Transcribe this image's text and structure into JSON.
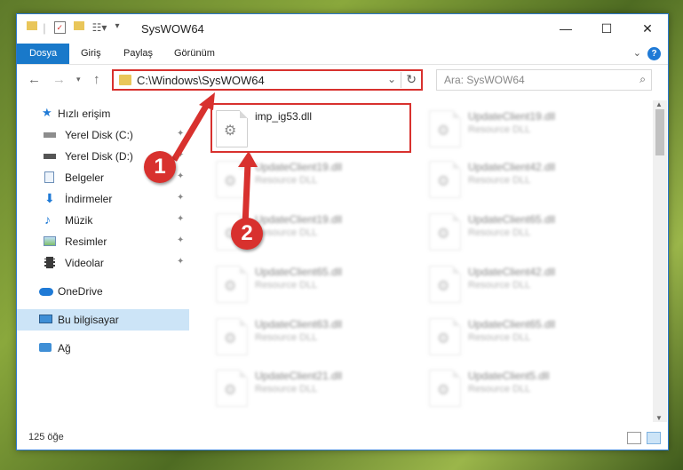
{
  "window": {
    "title": "SysWOW64"
  },
  "window_controls": {
    "minimize": "—",
    "maximize": "☐",
    "close": "✕"
  },
  "ribbon": {
    "tabs": [
      "Dosya",
      "Giriş",
      "Paylaş",
      "Görünüm"
    ],
    "help": "?"
  },
  "address": {
    "path": "C:\\Windows\\SysWOW64"
  },
  "search": {
    "placeholder": "Ara: SysWOW64"
  },
  "sidebar": {
    "items": [
      {
        "label": "Hızlı erişim",
        "icon": "star-icon"
      },
      {
        "label": "Yerel Disk (C:)",
        "icon": "drive-icon"
      },
      {
        "label": "Yerel Disk (D:)",
        "icon": "drive-icon"
      },
      {
        "label": "Belgeler",
        "icon": "documents-icon"
      },
      {
        "label": "İndirmeler",
        "icon": "download-arrow-icon"
      },
      {
        "label": "Müzik",
        "icon": "music-note-icon"
      },
      {
        "label": "Resimler",
        "icon": "pictures-icon"
      },
      {
        "label": "Videolar",
        "icon": "film-icon"
      },
      {
        "label": "OneDrive",
        "icon": "cloud-icon"
      },
      {
        "label": "Bu bilgisayar",
        "icon": "computer-icon",
        "selected": true
      },
      {
        "label": "Ağ",
        "icon": "network-icon"
      }
    ]
  },
  "files": [
    {
      "name": "imp_ig53.dll",
      "desc": "",
      "highlighted": true
    },
    {
      "name": "UpdateClient19.dll",
      "desc": "Resource DLL"
    },
    {
      "name": "UpdateClient19.dll",
      "desc": "Resource DLL"
    },
    {
      "name": "UpdateClient42.dll",
      "desc": "Resource DLL"
    },
    {
      "name": "UpdateClient19.dll",
      "desc": "Resource DLL"
    },
    {
      "name": "UpdateClient65.dll",
      "desc": "Resource DLL"
    },
    {
      "name": "UpdateClient65.dll",
      "desc": "Resource DLL"
    },
    {
      "name": "UpdateClient42.dll",
      "desc": "Resource DLL"
    },
    {
      "name": "UpdateClient63.dll",
      "desc": "Resource DLL"
    },
    {
      "name": "UpdateClient65.dll",
      "desc": "Resource DLL"
    },
    {
      "name": "UpdateClient21.dll",
      "desc": "Resource DLL"
    },
    {
      "name": "UpdateClient5.dll",
      "desc": "Resource DLL"
    }
  ],
  "status": {
    "count": "125 öğe"
  },
  "markers": [
    "1",
    "2"
  ],
  "colors": {
    "accent": "#1979ca",
    "highlight": "#d8312e",
    "selection": "#cce4f7"
  }
}
